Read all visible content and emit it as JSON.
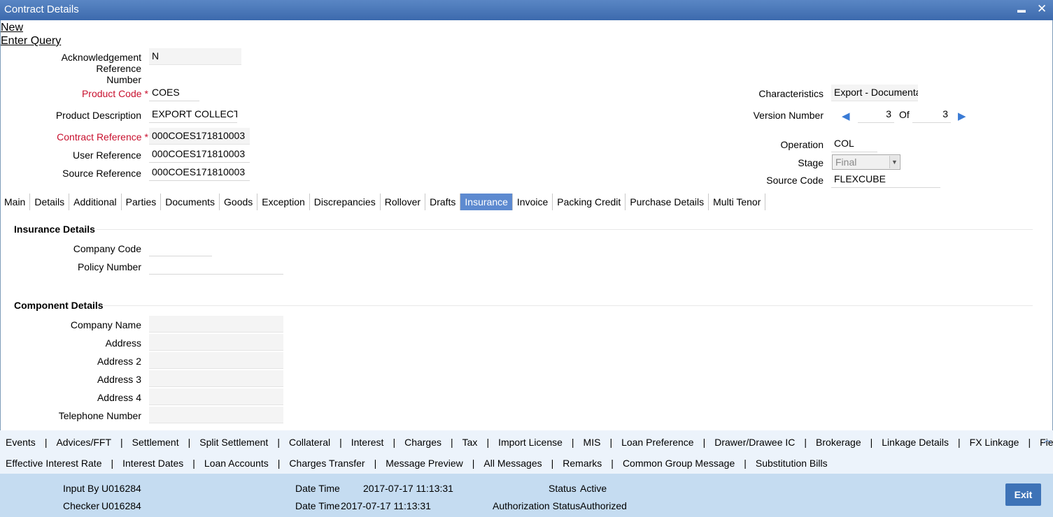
{
  "window": {
    "title": "Contract Details",
    "minimize": "▬",
    "close": "✕"
  },
  "menu": {
    "new": "New",
    "enter_query": "Enter Query"
  },
  "header": {
    "ack_ref_label_1": "Acknowledgement Reference",
    "ack_ref_label_2": "Number",
    "ack_ref_value": "N",
    "product_code_label": "Product Code",
    "product_code_value": "COES",
    "product_desc_label": "Product Description",
    "product_desc_value": "EXPORT COLLECTION",
    "contract_ref_label": "Contract Reference",
    "contract_ref_value": "000COES171810003",
    "user_ref_label": "User Reference",
    "user_ref_value": "000COES171810003",
    "source_ref_label": "Source Reference",
    "source_ref_value": "000COES171810003",
    "required_mark": "*",
    "characteristics_label": "Characteristics",
    "characteristics_value": "Export  - Documentary",
    "version_label": "Version Number",
    "version_current": "3",
    "version_of": "Of",
    "version_total": "3",
    "operation_label": "Operation",
    "operation_value": "COL",
    "stage_label": "Stage",
    "stage_value": "Final",
    "source_code_label": "Source Code",
    "source_code_value": "FLEXCUBE"
  },
  "tabs": [
    "Main",
    "Details",
    "Additional",
    "Parties",
    "Documents",
    "Goods",
    "Exception",
    "Discrepancies",
    "Rollover",
    "Drafts",
    "Insurance",
    "Invoice",
    "Packing Credit",
    "Purchase Details",
    "Multi Tenor"
  ],
  "active_tab": "Insurance",
  "insurance": {
    "title": "Insurance Details",
    "company_code_label": "Company Code",
    "company_code_value": "",
    "policy_number_label": "Policy Number",
    "policy_number_value": ""
  },
  "component": {
    "title": "Component Details",
    "company_name_label": "Company Name",
    "address_label": "Address",
    "address2_label": "Address 2",
    "address3_label": "Address 3",
    "address4_label": "Address 4",
    "telephone_label": "Telephone Number"
  },
  "toolbar_row1": [
    "Events",
    "Advices/FFT",
    "Settlement",
    "Split Settlement",
    "Collateral",
    "Interest",
    "Charges",
    "Tax",
    "Import License",
    "MIS",
    "Loan Preference",
    "Drawer/Drawee IC",
    "Brokerage",
    "Linkage Details",
    "FX Linkage",
    "Fields"
  ],
  "toolbar_row2": [
    "Effective Interest Rate",
    "Interest Dates",
    "Loan Accounts",
    "Charges Transfer",
    "Message Preview",
    "All Messages",
    "Remarks",
    "Common Group Message",
    "Substitution Bills"
  ],
  "footer": {
    "input_by_label": "Input By",
    "input_by_value": "U016284",
    "checker_label": "Checker",
    "checker_value": "U016284",
    "date_time_label": "Date Time",
    "date_time_1": "2017-07-17 11:13:31",
    "date_time_2": "2017-07-17 11:13:31",
    "status_label": "Status",
    "status_value": "Active",
    "auth_status_label": "Authorization Status",
    "auth_status_value": "Authorized",
    "exit_label": "Exit"
  }
}
